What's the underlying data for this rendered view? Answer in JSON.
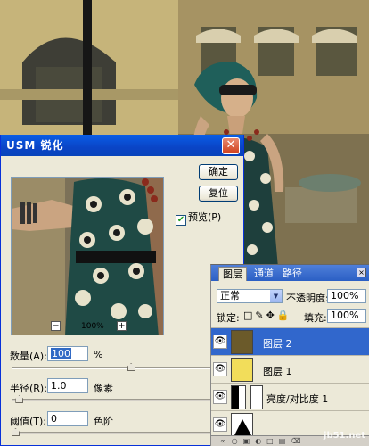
{
  "usm_dialog": {
    "title": "USM 锐化",
    "close_glyph": "✕",
    "ok_label": "确定",
    "reset_label": "复位",
    "preview_label": "预览(P)",
    "preview_checked": true,
    "zoom_out_glyph": "−",
    "zoom_in_glyph": "+",
    "zoom_value": "100%",
    "amount": {
      "label": "数量(A):",
      "value": "100",
      "unit": "%",
      "slider_fraction": 0.6
    },
    "radius": {
      "label": "半径(R):",
      "value": "1.0",
      "unit": "像素",
      "slider_fraction": 0.02
    },
    "threshold": {
      "label": "阈值(T):",
      "value": "0",
      "unit": "色阶",
      "slider_fraction": 0.0
    }
  },
  "layers_panel": {
    "tabs": [
      "图层",
      "通道",
      "路径"
    ],
    "active_tab": 0,
    "blend_mode": "正常",
    "opacity_label": "不透明度:",
    "opacity_value": "100%",
    "lock_label": "锁定:",
    "fill_label": "填充:",
    "fill_value": "100%",
    "layers": [
      {
        "name": "图层 2",
        "selected": true,
        "thumb_color": "#6b5a2a"
      },
      {
        "name": "图层 1",
        "selected": false,
        "thumb_color": "#f2dd5a"
      },
      {
        "name": "亮度/对比度 1",
        "selected": false,
        "thumb_color": "#000000"
      }
    ]
  },
  "watermark": "jb51.net"
}
